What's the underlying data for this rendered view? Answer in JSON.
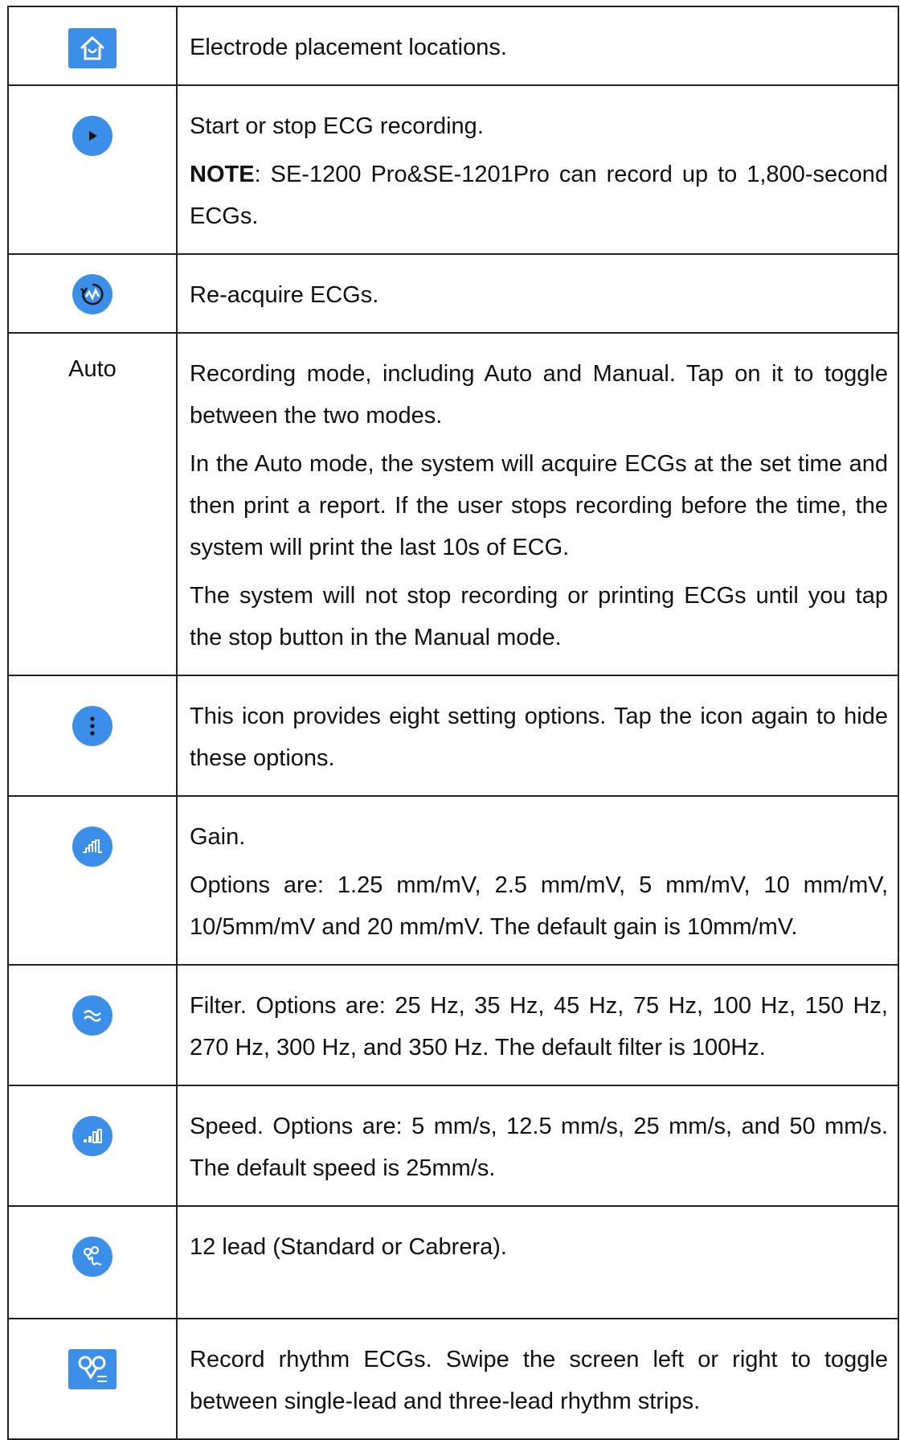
{
  "colors": {
    "accent": "#3b8fe8",
    "border": "#222222",
    "text": "#111111"
  },
  "rows": [
    {
      "icon": "house-icon",
      "paragraphs": [
        "Electrode placement locations."
      ]
    },
    {
      "icon": "play-icon",
      "paragraphs": [
        "Start or stop ECG recording."
      ],
      "note_label": "NOTE",
      "note_text": ": SE-1200 Pro&SE-1201Pro can record up to 1,800-second ECGs."
    },
    {
      "icon": "reacquire-icon",
      "paragraphs": [
        "Re-acquire ECGs."
      ]
    },
    {
      "label": "Auto",
      "paragraphs": [
        "Recording mode, including Auto and Manual. Tap on it to toggle between the two modes.",
        "In the Auto mode, the system will acquire ECGs at the set time and then print a report. If the user stops recording before the time, the system will print the last 10s of ECG.",
        "The system will not stop recording or printing ECGs until you tap the stop button in the Manual mode."
      ]
    },
    {
      "icon": "more-options-icon",
      "paragraphs": [
        "This icon provides eight setting options. Tap the icon again to hide these options."
      ]
    },
    {
      "icon": "gain-icon",
      "paragraphs": [
        "Gain.",
        "Options are: 1.25 mm/mV, 2.5 mm/mV, 5 mm/mV, 10 mm/mV, 10/5mm/mV and 20 mm/mV. The default gain is 10mm/mV."
      ]
    },
    {
      "icon": "filter-icon",
      "paragraphs": [
        "Filter. Options are: 25 Hz, 35 Hz, 45 Hz, 75 Hz, 100 Hz, 150 Hz, 270 Hz, 300 Hz, and 350 Hz. The default filter is 100Hz."
      ]
    },
    {
      "icon": "speed-icon",
      "paragraphs": [
        "Speed. Options are: 5 mm/s, 12.5 mm/s, 25 mm/s, and 50 mm/s. The default speed is 25mm/s."
      ]
    },
    {
      "icon": "lead-icon",
      "paragraphs": [
        "12 lead (Standard or Cabrera)."
      ]
    },
    {
      "icon": "rhythm-icon",
      "paragraphs": [
        "Record rhythm ECGs. Swipe the screen left or right to toggle between single-lead and three-lead rhythm strips."
      ]
    }
  ]
}
